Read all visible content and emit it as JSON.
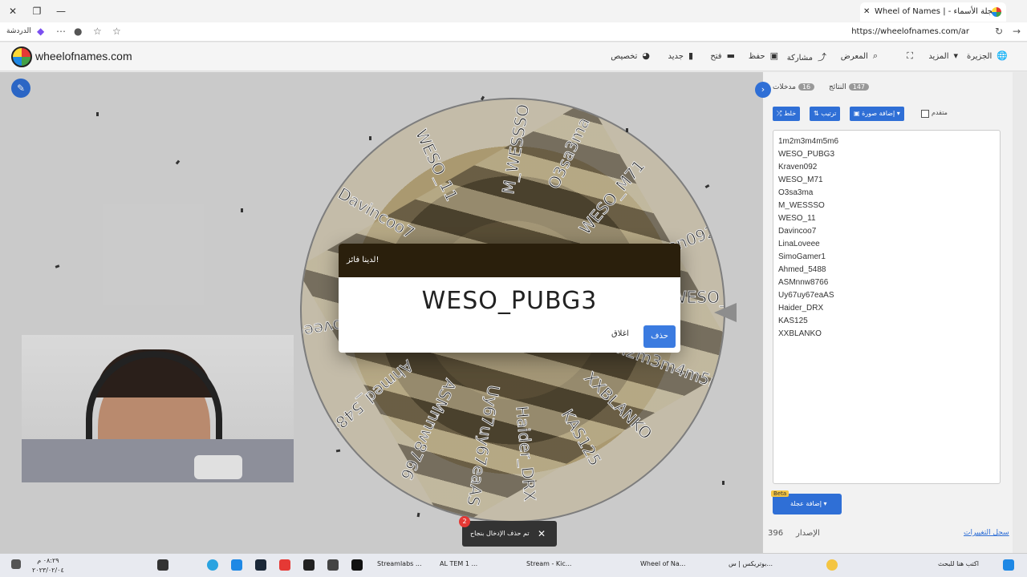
{
  "browser": {
    "tab_title": "Wheel of Names | عجلة الأسماء - منتقي الاسم العشوائي",
    "url": "https://wheelofnames.com/ar",
    "left_label": "الدردشة"
  },
  "site": {
    "brand": "wheelofnames.com",
    "nav": [
      {
        "label": "الجزيرة",
        "icon": "globe-icon"
      },
      {
        "label": "المزيد",
        "icon": "chevron-down-icon"
      },
      {
        "label": "",
        "icon": "fullscreen-icon"
      },
      {
        "label": "المعرض",
        "icon": "search-icon"
      },
      {
        "label": "مشاركة",
        "icon": "share-icon"
      },
      {
        "label": "حفظ",
        "icon": "save-icon"
      },
      {
        "label": "فتح",
        "icon": "folder-icon"
      },
      {
        "label": "جديد",
        "icon": "file-icon"
      },
      {
        "label": "تخصيص",
        "icon": "palette-icon"
      }
    ]
  },
  "wheel": {
    "labels": [
      "WESO_11",
      "M_WESSSO",
      "O3sa3ma",
      "WESO_M71",
      "Kraven092",
      "WESO_PUBG3",
      "1m2m3m4m5m6",
      "XXBLANKO",
      "KAS125",
      "Haider_DRX",
      "Uy67uy67eaAS",
      "ASMnnw8766",
      "Ahmed_5488",
      "LinaLoveee",
      "Davincoo7"
    ]
  },
  "dialog": {
    "title": "لدينا فائز!",
    "winner": "WESO_PUBG3",
    "close_label": "اغلاق",
    "remove_label": "حذف"
  },
  "panel": {
    "tab_entries": "مدخلات",
    "tab_entries_count": "16",
    "tab_results": "النتائج",
    "tab_results_count": "147",
    "shuffle_label": "خلط",
    "sort_label": "ترتيب",
    "add_image_label": "إضافة صورة",
    "advanced_label": "متقدم",
    "entries": [
      "1m2m3m4m5m6",
      "WESO_PUBG3",
      "Kraven092",
      "WESO_M71",
      "O3sa3ma",
      "M_WESSSO",
      "WESO_11",
      "Davincoo7",
      "LinaLoveee",
      "SimoGamer1",
      "Ahmed_5488",
      "ASMnnw8766",
      "Uy67uy67eaAS",
      "Haider_DRX",
      "KAS125",
      "XXBLANKO"
    ],
    "add_wheel_label": "إضافة عجلة",
    "beta_label": "Beta",
    "version_label": "الإصدار",
    "version_number": "396",
    "changelog_label": "سجل التغييرات"
  },
  "toast": {
    "badge": "2",
    "message": "تم حذف الإدخال بنجاح"
  },
  "taskbar": {
    "search_placeholder": "اكتب هنا للبحث",
    "items": [
      "بوتريكس | س...",
      "Wheel of Na...",
      "Stream - Kic...",
      "AL TEM 1 ...",
      "Streamlabs ..."
    ],
    "time": "٠٨:٢٩ م",
    "date": "٢٠٢٣/٠٢/٠٤"
  }
}
